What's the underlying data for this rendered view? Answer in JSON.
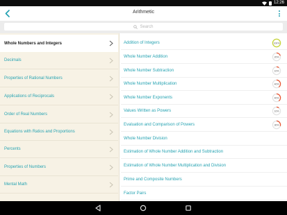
{
  "status": {
    "time": "12:26"
  },
  "header": {
    "title": "Arithmetic"
  },
  "search": {
    "placeholder": "Search"
  },
  "sidebar": {
    "items": [
      {
        "label": "Whole Numbers and Integers",
        "selected": true
      },
      {
        "label": "Decimals",
        "selected": false
      },
      {
        "label": "Properties of Rational Numbers",
        "selected": false
      },
      {
        "label": "Applications of Reciprocals",
        "selected": false
      },
      {
        "label": "Order of Real Numbers",
        "selected": false
      },
      {
        "label": "Equations with Ratios and Proportions",
        "selected": false
      },
      {
        "label": "Percents",
        "selected": false
      },
      {
        "label": "Properties of Numbers",
        "selected": false
      },
      {
        "label": "Mental Math",
        "selected": false
      }
    ]
  },
  "topics": {
    "items": [
      {
        "label": "Addition of Integers",
        "score": "100%",
        "progress": 1.0,
        "color": "#c6d534"
      },
      {
        "label": "Whole Number Addition",
        "score": "20%",
        "progress": 0.2,
        "color": "#e8532f"
      },
      {
        "label": "Whole Number Subtraction",
        "score": "10%",
        "progress": 0.1,
        "color": "#e8532f"
      },
      {
        "label": "Whole Number Multiplication",
        "score": "40%",
        "progress": 0.4,
        "color": "#e8532f"
      },
      {
        "label": "Whole Number Exponents",
        "score": "40%",
        "progress": 0.4,
        "color": "#e8532f"
      },
      {
        "label": "Values Written as Powers",
        "score": "10%",
        "progress": 0.1,
        "color": "#e8532f"
      },
      {
        "label": "Evaluation and Comparison of Powers",
        "score": "30%",
        "progress": 0.3,
        "color": "#e8532f"
      },
      {
        "label": "Whole Number Division"
      },
      {
        "label": "Estimation of Whole Number Addition and Subtraction"
      },
      {
        "label": "Estimation of Whole Number Multiplication and Division"
      },
      {
        "label": "Prime and Composite Numbers"
      },
      {
        "label": "Factor Pairs"
      }
    ]
  },
  "colors": {
    "accent": "#27a3b2",
    "sidebar_bg": "#f7f2e5",
    "track": "#e2e2e2"
  }
}
